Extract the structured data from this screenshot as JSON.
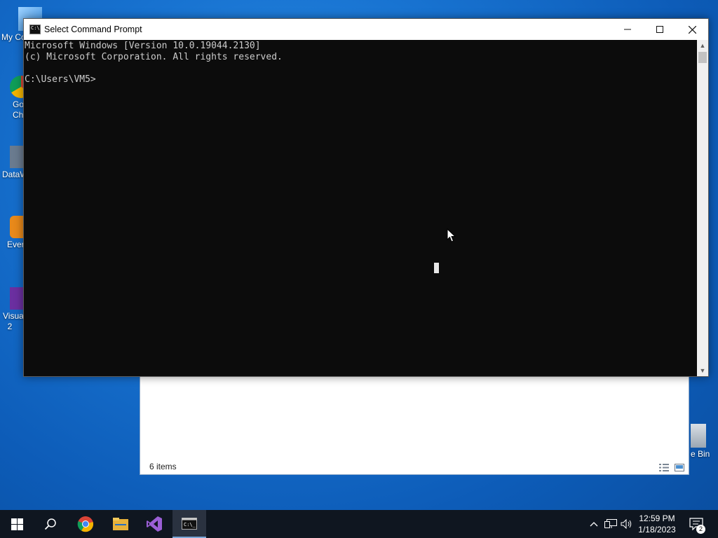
{
  "desktop": {
    "icons": [
      {
        "label": "My Co",
        "icon": "computer-icon"
      },
      {
        "label": "Go\nCh",
        "icon": "chrome-icon"
      },
      {
        "label": "DataW",
        "icon": "datawrapper-icon"
      },
      {
        "label": "Ever",
        "icon": "evernote-icon"
      },
      {
        "label": "Visua\n2",
        "icon": "visual-studio-icon"
      },
      {
        "label": "e Bin",
        "icon": "recycle-bin-icon"
      }
    ]
  },
  "explorer": {
    "status_text": "6 items"
  },
  "cmd_window": {
    "title": "Select Command Prompt",
    "lines": [
      "Microsoft Windows [Version 10.0.19044.2130]",
      "(c) Microsoft Corporation. All rights reserved.",
      "",
      "C:\\Users\\VM5>"
    ]
  },
  "taskbar": {
    "apps": [
      "start-icon",
      "search-icon",
      "chrome-icon",
      "file-explorer-icon",
      "visual-studio-icon",
      "command-prompt-icon"
    ],
    "clock_time": "12:59 PM",
    "clock_date": "1/18/2023",
    "notification_count": "2"
  }
}
